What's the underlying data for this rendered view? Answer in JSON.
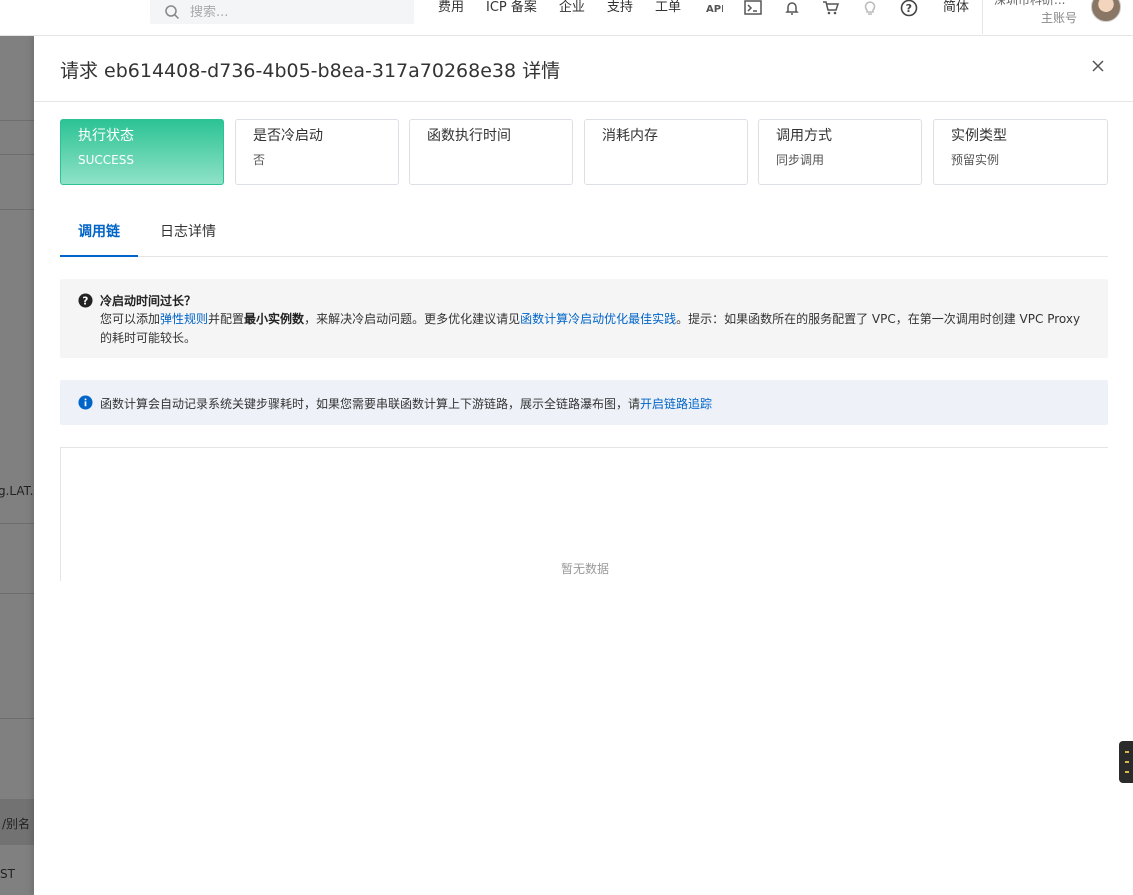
{
  "topbar": {
    "search_placeholder": "搜索...",
    "nav_items": [
      "费用",
      "ICP 备案",
      "企业",
      "支持",
      "工单"
    ],
    "language": "简体",
    "account_name": "深圳市科研...",
    "account_sub": "主账号"
  },
  "backdrop": {
    "text_1": "g.LAT...",
    "text_2": "/别名",
    "text_3": "ST"
  },
  "drawer": {
    "title": "请求 eb614408-d736-4b05-b8ea-317a70268e38 详情",
    "cards": [
      {
        "title": "执行状态",
        "value": "SUCCESS"
      },
      {
        "title": "是否冷启动",
        "value": "否"
      },
      {
        "title": "函数执行时间",
        "value": ""
      },
      {
        "title": "消耗内存",
        "value": ""
      },
      {
        "title": "调用方式",
        "value": "同步调用"
      },
      {
        "title": "实例类型",
        "value": "预留实例"
      }
    ],
    "tabs": [
      {
        "label": "调用链"
      },
      {
        "label": "日志详情"
      }
    ],
    "tip": {
      "title": "冷启动时间过长？",
      "seg_1": "您可以添加",
      "link_1": "弹性规则",
      "seg_2": "并配置",
      "bold_1": "最小实例数",
      "seg_3": "，来解决冷启动问题。更多优化建议请见",
      "link_2": "函数计算冷启动优化最佳实践",
      "seg_4": "。提示：如果函数所在的服务配置了 VPC，在第一次调用时创建 VPC Proxy 的耗时可能较长。"
    },
    "info": {
      "text": "函数计算会自动记录系统关键步骤耗时，如果您需要串联函数计算上下游链路，展示全链路瀑布图，请",
      "link": "开启链路追踪"
    },
    "empty_text": "暂无数据"
  },
  "colors": {
    "accent": "#0064c8",
    "success_card": "#2cc394"
  }
}
